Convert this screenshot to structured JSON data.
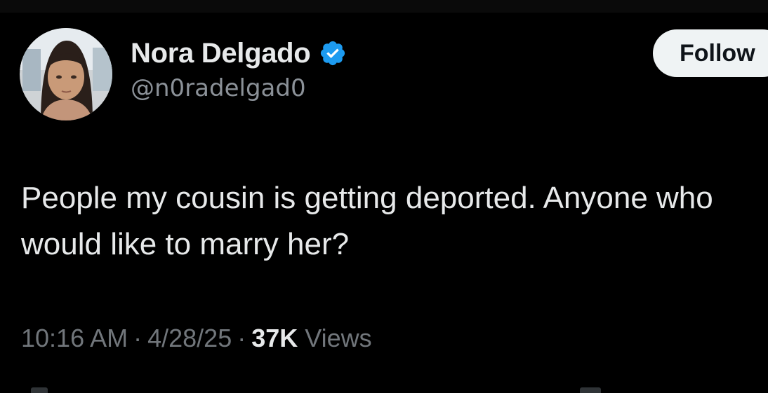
{
  "author": {
    "display_name": "Nora Delgado",
    "handle": "@n0radelgad0",
    "verified": true,
    "avatar_icon": "profile-photo"
  },
  "follow_button": {
    "label": "Follow"
  },
  "tweet": {
    "text": "People my cousin is getting deported. Anyone who would like to marry her?",
    "time": "10:16 AM",
    "date": "4/28/25",
    "separator": "·",
    "views_count": "37K",
    "views_label": "Views"
  },
  "colors": {
    "background": "#000000",
    "text_primary": "#e7e9ea",
    "text_secondary": "#71767b",
    "verified_badge": "#1d9bf0",
    "follow_button_bg": "#eff3f4"
  }
}
